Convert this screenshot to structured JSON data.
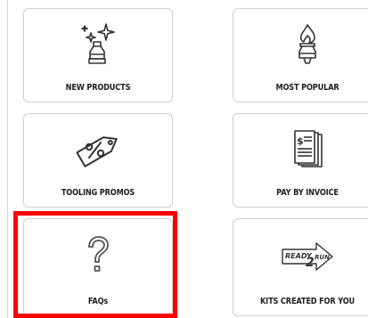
{
  "tiles": [
    {
      "label": "NEW PRODUCTS",
      "icon": "sparkle-bottle-icon"
    },
    {
      "label": "MOST POPULAR",
      "icon": "flame-bottle-icon"
    },
    {
      "label": "TOOLING PROMOS",
      "icon": "percent-tag-icon"
    },
    {
      "label": "PAY BY INVOICE",
      "icon": "invoice-icon"
    },
    {
      "label": "FAQs",
      "icon": "question-mark-icon",
      "highlighted": true
    },
    {
      "label": "KITS CREATED FOR YOU",
      "icon": "ready-2-run-logo-icon",
      "logo_text": "READY 2 RUN"
    }
  ],
  "colors": {
    "highlight": "#ff0000",
    "tile_border": "#cfcfcf",
    "label_text": "#222222",
    "icon_stroke": "#333333"
  }
}
